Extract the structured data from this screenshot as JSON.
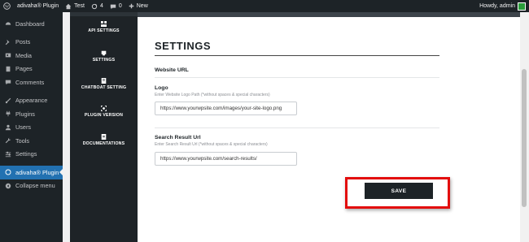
{
  "adminbar": {
    "site_name": "adivaha® Plugin",
    "home_label": "Test",
    "updates_count": "4",
    "comments_count": "0",
    "new_label": "New",
    "howdy": "Howdy, admin"
  },
  "sidebar": {
    "items": [
      {
        "label": "Dashboard"
      },
      {
        "label": "Posts"
      },
      {
        "label": "Media"
      },
      {
        "label": "Pages"
      },
      {
        "label": "Comments"
      },
      {
        "label": "Appearance"
      },
      {
        "label": "Plugins"
      },
      {
        "label": "Users"
      },
      {
        "label": "Tools"
      },
      {
        "label": "Settings"
      },
      {
        "label": "adivaha® Plugin"
      },
      {
        "label": "Collapse menu"
      }
    ]
  },
  "plugin_nav": {
    "items": [
      {
        "label": "API SETTINGS"
      },
      {
        "label": "SETTINGS"
      },
      {
        "label": "CHATBOAT SETTING"
      },
      {
        "label": "PLUGIN VERSION"
      },
      {
        "label": "DOCUMENTATIONS"
      }
    ]
  },
  "main": {
    "title": "SETTINGS",
    "website_url_label": "Website URL",
    "logo_label": "Logo",
    "logo_hint": "Enter Website Logo Path (*without spaces & special characters)",
    "logo_value": "https://www.yourwpsite.com/images/your-site-logo.png",
    "search_label": "Search Result Url",
    "search_hint": "Enter Search Result Url (*without spaces & special characters)",
    "search_value": "https://www.yourwpsite.com/search-results/",
    "save_label": "SAVE"
  },
  "colors": {
    "admin_dark": "#1d2327",
    "active_blue": "#2271b1",
    "highlight_red": "#e30d0d"
  }
}
